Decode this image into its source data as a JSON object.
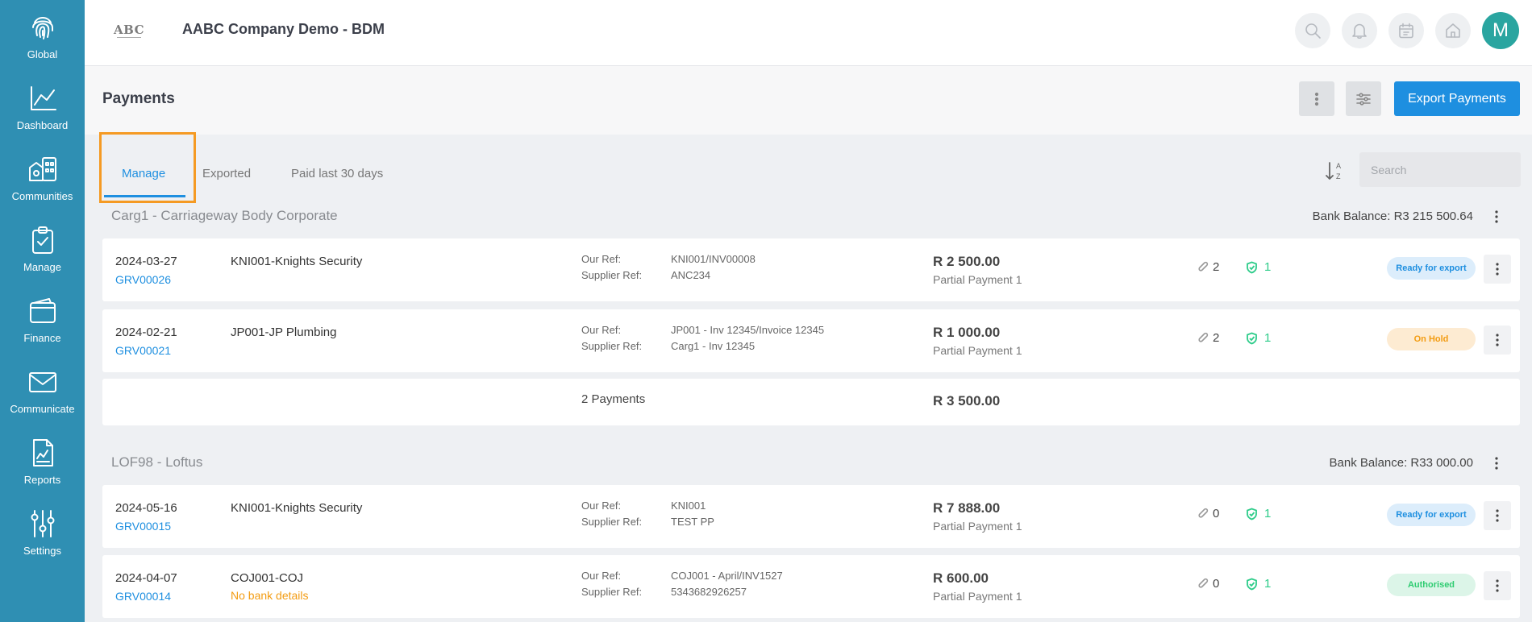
{
  "sidebar": {
    "items": [
      {
        "label": "Global",
        "icon": "fingerprint-icon"
      },
      {
        "label": "Dashboard",
        "icon": "chart-line-icon"
      },
      {
        "label": "Communities",
        "icon": "buildings-icon"
      },
      {
        "label": "Manage",
        "icon": "clipboard-check-icon"
      },
      {
        "label": "Finance",
        "icon": "wallet-icon"
      },
      {
        "label": "Communicate",
        "icon": "envelope-icon"
      },
      {
        "label": "Reports",
        "icon": "report-icon"
      },
      {
        "label": "Settings",
        "icon": "sliders-icon"
      }
    ],
    "color": "#2f8fb3"
  },
  "topbar": {
    "logo_text": "ABC",
    "company_name": "AABC Company Demo - BDM",
    "avatar_letter": "M",
    "icons": [
      "search-icon",
      "bell-icon",
      "calendar-icon",
      "home-icon"
    ]
  },
  "page": {
    "title": "Payments",
    "export_label": "Export Payments",
    "accent": "#1e8fe0"
  },
  "tabs": [
    {
      "label": "Manage",
      "active": true
    },
    {
      "label": "Exported",
      "active": false
    },
    {
      "label": "Paid last 30 days",
      "active": false
    }
  ],
  "search": {
    "placeholder": "Search",
    "value": ""
  },
  "labels": {
    "our_ref": "Our Ref:",
    "supplier_ref": "Supplier Ref:"
  },
  "groups": [
    {
      "title": "Carg1 - Carriageway Body Corporate",
      "bank_balance": "Bank Balance: R3 215 500.64",
      "payments": [
        {
          "date": "2024-03-27",
          "grv": "GRV00026",
          "supplier": "KNI001-Knights Security",
          "warning": "",
          "our_ref": "KNI001/INV00008",
          "supplier_ref": "ANC234",
          "amount": "R 2 500.00",
          "type": "Partial Payment 1",
          "attachments": "2",
          "approvals": "1",
          "status": "Ready for export"
        },
        {
          "date": "2024-02-21",
          "grv": "GRV00021",
          "supplier": "JP001-JP Plumbing",
          "warning": "",
          "our_ref": "JP001 - Inv 12345/Invoice 12345",
          "supplier_ref": "Carg1 - Inv 12345",
          "amount": "R 1 000.00",
          "type": "Partial Payment 1",
          "attachments": "2",
          "approvals": "1",
          "status": "On Hold"
        }
      ],
      "summary_count": "2 Payments",
      "summary_total": "R 3 500.00"
    },
    {
      "title": "LOF98 - Loftus",
      "bank_balance": "Bank Balance: R33 000.00",
      "payments": [
        {
          "date": "2024-05-16",
          "grv": "GRV00015",
          "supplier": "KNI001-Knights Security",
          "warning": "",
          "our_ref": "KNI001",
          "supplier_ref": "TEST PP",
          "amount": "R 7 888.00",
          "type": "Partial Payment 1",
          "attachments": "0",
          "approvals": "1",
          "status": "Ready for export"
        },
        {
          "date": "2024-04-07",
          "grv": "GRV00014",
          "supplier": "COJ001-COJ",
          "warning": "No bank details",
          "our_ref": "COJ001 - April/INV1527",
          "supplier_ref": "5343682926257",
          "amount": "R 600.00",
          "type": "Partial Payment 1",
          "attachments": "0",
          "approvals": "1",
          "status": "Authorised"
        }
      ]
    }
  ],
  "status_colors": {
    "Ready for export": {
      "bg": "#dcedfb",
      "fg": "#1e8fe0"
    },
    "On Hold": {
      "bg": "#fdebd2",
      "fg": "#f39c12"
    },
    "Authorised": {
      "bg": "#dcf5e8",
      "fg": "#2ecc71"
    }
  }
}
